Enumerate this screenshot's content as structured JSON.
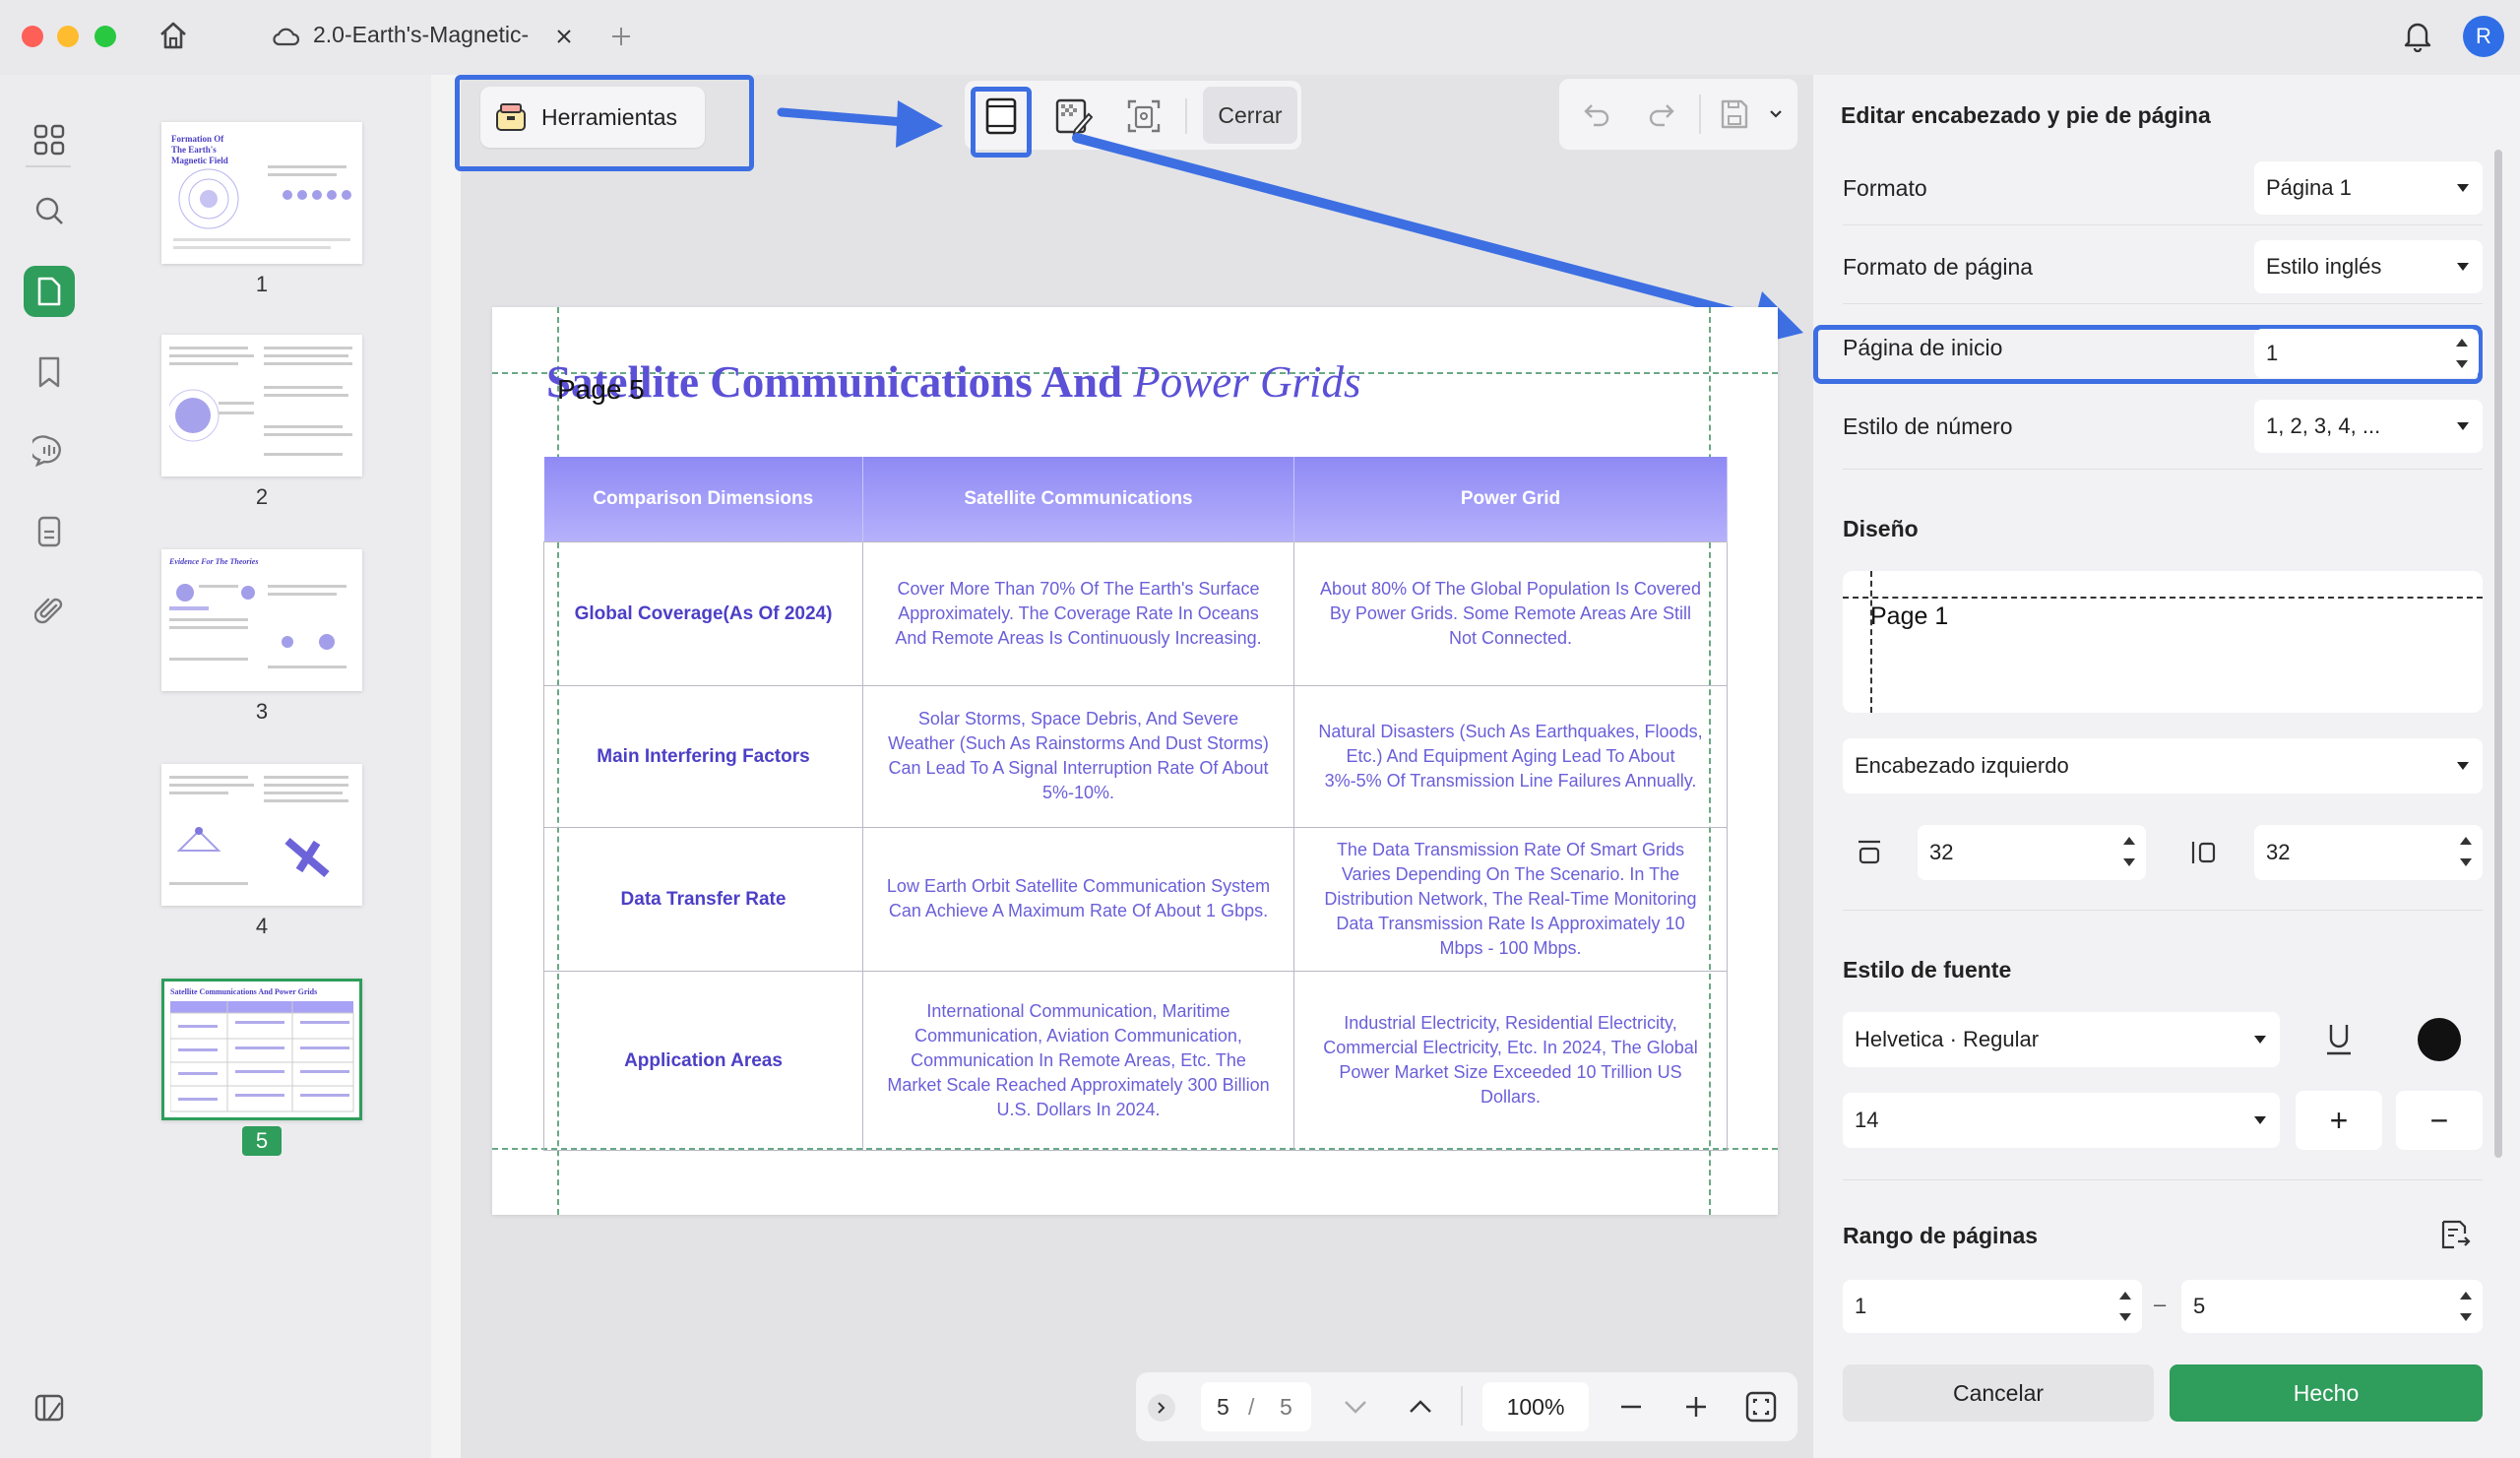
{
  "window": {
    "tab_title": "2.0-Earth's-Magnetic-",
    "avatar_letter": "R"
  },
  "colors": {
    "accent_green": "#2f9d5b",
    "annotation_blue": "#3d6fe3",
    "table_header": "#9d98f7",
    "title_purple": "#5b50d6"
  },
  "icons": {
    "titlebar": [
      "home-icon",
      "cloud-icon",
      "close-tab-icon",
      "new-tab-icon",
      "bell-icon"
    ],
    "rail": [
      "grid-icon",
      "search-icon",
      "page-edit-icon",
      "bookmark-icon",
      "comment-icon",
      "form-icon",
      "paperclip-icon",
      "sidebar-toggle-icon"
    ],
    "toolbar": [
      "toolbox-icon",
      "header-footer-icon",
      "watermark-icon",
      "background-icon",
      "undo-icon",
      "redo-icon",
      "save-icon"
    ]
  },
  "toolbar": {
    "tools_label": "Herramientas",
    "close_label": "Cerrar"
  },
  "thumbnails": [
    {
      "num": "1",
      "title": "Formation Of The Earth's Magnetic Field"
    },
    {
      "num": "2",
      "title": ""
    },
    {
      "num": "3",
      "title": "Evidence For The Theories"
    },
    {
      "num": "4",
      "title": ""
    },
    {
      "num": "5",
      "title": "Satellite Communications And Power Grids"
    }
  ],
  "document": {
    "title_bold": "Satellite Communications And",
    "title_italic": "Power Grids",
    "header_text": "Page 5",
    "table": {
      "headers": [
        "Comparison Dimensions",
        "Satellite Communications",
        "Power Grid"
      ],
      "rows": [
        [
          "Global Coverage(As Of 2024)",
          "Cover More Than 70% Of The Earth's Surface Approximately. The Coverage Rate In Oceans And Remote Areas Is Continuously Increasing.",
          "About 80% Of The Global Population Is Covered By Power Grids. Some Remote Areas Are Still Not Connected."
        ],
        [
          "Main Interfering Factors",
          "Solar Storms, Space Debris, And Severe Weather (Such As Rainstorms And Dust Storms) Can Lead To A Signal Interruption Rate Of About 5%-10%.",
          "Natural Disasters (Such As Earthquakes, Floods, Etc.) And Equipment Aging Lead To About 3%-5% Of Transmission Line Failures Annually."
        ],
        [
          "Data Transfer Rate",
          "Low Earth Orbit Satellite Communication System Can Achieve A Maximum Rate Of About 1 Gbps.",
          "The Data Transmission Rate Of Smart Grids Varies Depending On The Scenario. In The Distribution Network, The Real-Time Monitoring Data Transmission Rate Is Approximately 10 Mbps - 100 Mbps."
        ],
        [
          "Application Areas",
          "International Communication, Maritime Communication, Aviation Communication, Communication In Remote Areas, Etc. The Market Scale Reached Approximately 300 Billion U.S. Dollars In 2024.",
          "Industrial Electricity, Residential Electricity, Commercial Electricity, Etc. In 2024, The Global Power Market Size Exceeded 10 Trillion US Dollars."
        ]
      ]
    }
  },
  "pager": {
    "current": "5",
    "separator": "/",
    "total": "5",
    "zoom": "100%"
  },
  "panel": {
    "title": "Editar encabezado y pie de página",
    "format_label": "Formato",
    "format_value": "Página 1",
    "page_format_label": "Formato de página",
    "page_format_value": "Estilo inglés",
    "start_page_label": "Página de inicio",
    "start_page_value": "1",
    "number_style_label": "Estilo de número",
    "number_style_value": "1, 2, 3, 4, ...",
    "design_label": "Diseño",
    "preview_text": "Page 1",
    "position_value": "Encabezado izquierdo",
    "margin_top_value": "32",
    "margin_side_value": "32",
    "font_style_label": "Estilo de fuente",
    "font_value": "Helvetica · Regular",
    "font_size_value": "14",
    "plus": "+",
    "minus": "−",
    "range_label": "Rango de páginas",
    "range_from": "1",
    "range_dash": "–",
    "range_to": "5",
    "cancel_label": "Cancelar",
    "done_label": "Hecho"
  }
}
